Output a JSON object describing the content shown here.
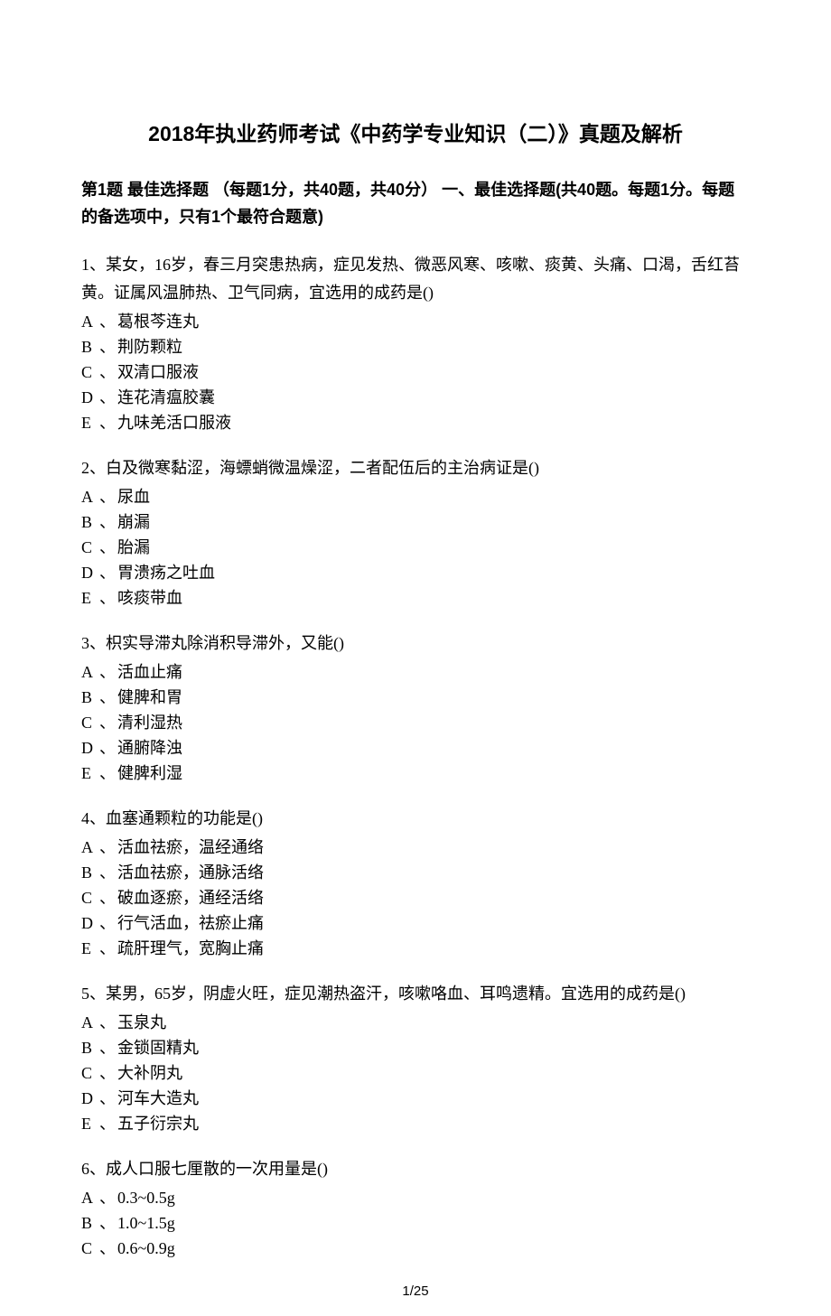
{
  "title": "2018年执业药师考试《中药学专业知识（二）》真题及解析",
  "section_header": "第1题 最佳选择题 （每题1分，共40题，共40分） 一、最佳选择题(共40题。每题1分。每题的备选项中，只有1个最符合题意)",
  "questions": [
    {
      "stem": "1、某女，16岁，春三月突患热病，症见发热、微恶风寒、咳嗽、痰黄、头痛、口渴，舌红苔黄。证属风温肺热、卫气同病，宜选用的成药是()",
      "options": [
        {
          "label": "A",
          "text": "葛根芩连丸"
        },
        {
          "label": "B",
          "text": "荆防颗粒"
        },
        {
          "label": "C",
          "text": "双清口服液"
        },
        {
          "label": "D",
          "text": "连花清瘟胶囊"
        },
        {
          "label": "E",
          "text": "九味羌活口服液"
        }
      ]
    },
    {
      "stem": "2、白及微寒黏涩，海螵蛸微温燥涩，二者配伍后的主治病证是()",
      "options": [
        {
          "label": "A",
          "text": "尿血"
        },
        {
          "label": "B",
          "text": "崩漏"
        },
        {
          "label": "C",
          "text": "胎漏"
        },
        {
          "label": "D",
          "text": "胃溃疡之吐血"
        },
        {
          "label": "E",
          "text": "咳痰带血"
        }
      ]
    },
    {
      "stem": "3、枳实导滞丸除消积导滞外，又能()",
      "options": [
        {
          "label": "A",
          "text": "活血止痛"
        },
        {
          "label": "B",
          "text": "健脾和胃"
        },
        {
          "label": "C",
          "text": "清利湿热"
        },
        {
          "label": "D",
          "text": "通腑降浊"
        },
        {
          "label": "E",
          "text": "健脾利湿"
        }
      ]
    },
    {
      "stem": "4、血塞通颗粒的功能是()",
      "options": [
        {
          "label": "A",
          "text": "活血祛瘀，温经通络"
        },
        {
          "label": "B",
          "text": "活血祛瘀，通脉活络"
        },
        {
          "label": "C",
          "text": "破血逐瘀，通经活络"
        },
        {
          "label": "D",
          "text": "行气活血，祛瘀止痛"
        },
        {
          "label": "E",
          "text": "疏肝理气，宽胸止痛"
        }
      ]
    },
    {
      "stem": "5、某男，65岁，阴虚火旺，症见潮热盗汗，咳嗽咯血、耳鸣遗精。宜选用的成药是()",
      "options": [
        {
          "label": "A",
          "text": "玉泉丸"
        },
        {
          "label": "B",
          "text": "金锁固精丸"
        },
        {
          "label": "C",
          "text": "大补阴丸"
        },
        {
          "label": "D",
          "text": "河车大造丸"
        },
        {
          "label": "E",
          "text": "五子衍宗丸"
        }
      ]
    },
    {
      "stem": "6、成人口服七厘散的一次用量是()",
      "options": [
        {
          "label": "A",
          "text": "0.3~0.5g"
        },
        {
          "label": "B",
          "text": "1.0~1.5g"
        },
        {
          "label": "C",
          "text": "0.6~0.9g"
        }
      ]
    }
  ],
  "page_number": "1/25"
}
